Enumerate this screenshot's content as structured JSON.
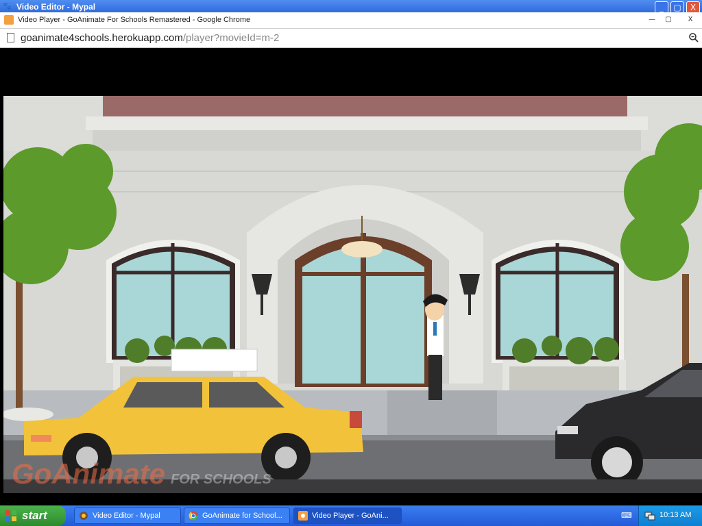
{
  "back_window": {
    "title": "Video Editor - Mypal",
    "controls": {
      "minimize": "_",
      "maximize": "▢",
      "close": "X"
    }
  },
  "popup_window": {
    "title": "Video Player - GoAnimate For Schools Remastered - Google Chrome",
    "controls": {
      "minimize": "—",
      "maximize": "▢",
      "close": "X"
    },
    "address_host": "goanimate4schools.herokuapp.com",
    "address_path": "/player?movieId=m-2"
  },
  "watermark": {
    "brand": "GoAnimate",
    "suffix": "FOR SCHOOLS"
  },
  "taskbar": {
    "start_label": "start",
    "tasks": [
      {
        "label": "Video Editor - Mypal"
      },
      {
        "label": "GoAnimate for School..."
      },
      {
        "label": "Video Player - GoAni..."
      }
    ],
    "clock": "10:13 AM"
  }
}
